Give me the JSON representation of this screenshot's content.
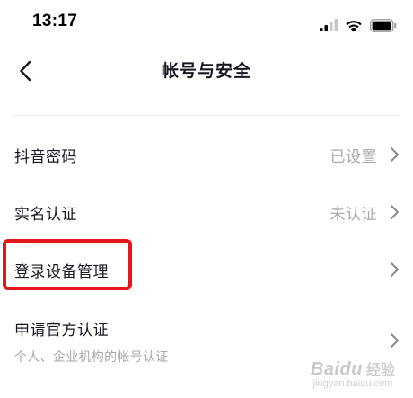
{
  "status_bar": {
    "time": "13:17"
  },
  "nav": {
    "title": "帐号与安全"
  },
  "settings": [
    {
      "label": "抖音密码",
      "value": "已设置"
    },
    {
      "label": "实名认证",
      "value": "未认证"
    },
    {
      "label": "登录设备管理"
    },
    {
      "label": "申请官方认证",
      "subtitle": "个人、企业机构的帐号认证"
    }
  ],
  "watermark": {
    "brand": "Baidu",
    "brand_cn": "经验",
    "url": "jingyan.baidu.com"
  },
  "colors": {
    "text": "#161823",
    "secondary": "#a8a9ae",
    "highlight": "#e5151c"
  },
  "icons": [
    "cellular-signal-icon",
    "wifi-icon",
    "battery-icon",
    "back-arrow-icon",
    "chevron-right-icon"
  ]
}
